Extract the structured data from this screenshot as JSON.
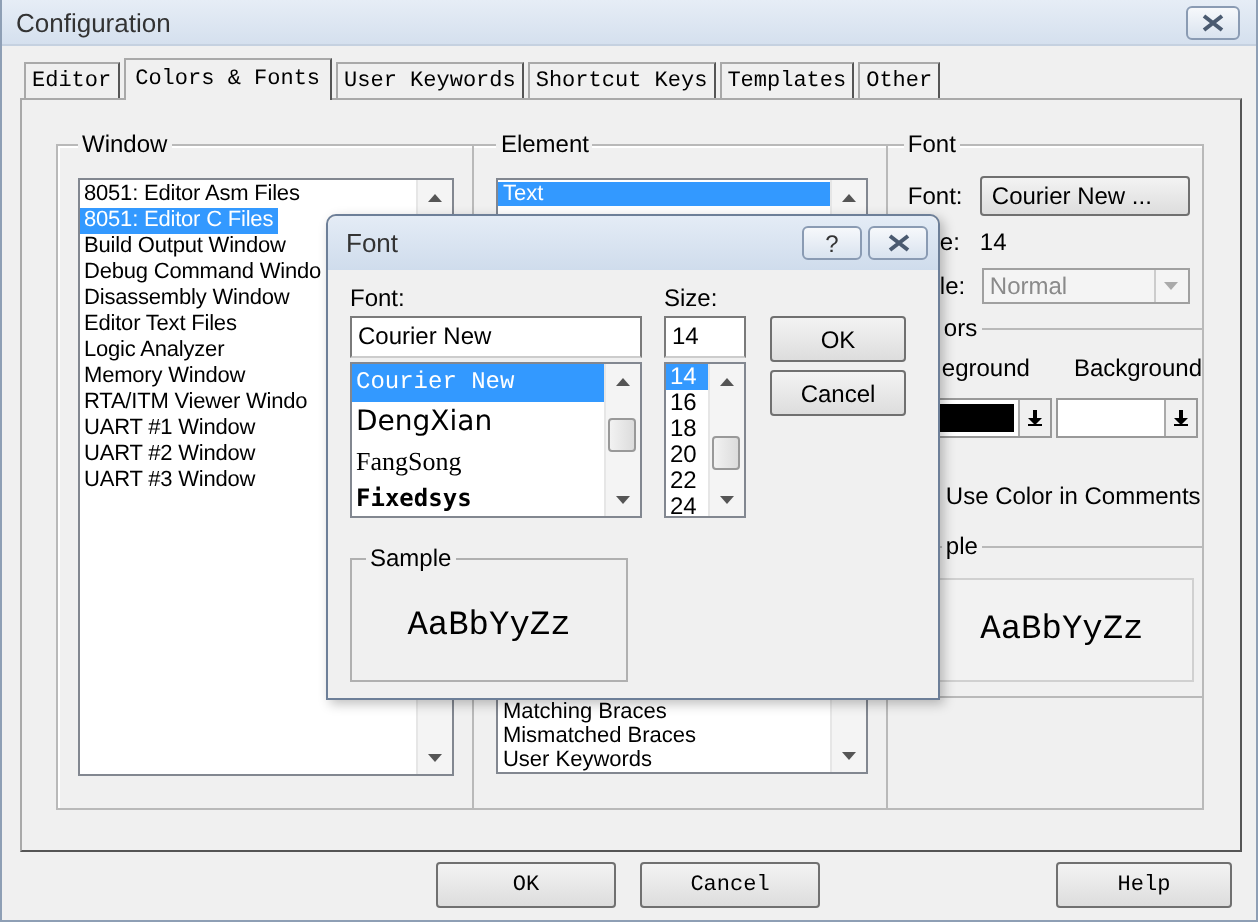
{
  "window": {
    "title": "Configuration"
  },
  "tabs": [
    {
      "label": "Editor",
      "selected": false
    },
    {
      "label": "Colors & Fonts",
      "selected": true
    },
    {
      "label": "User Keywords",
      "selected": false
    },
    {
      "label": "Shortcut Keys",
      "selected": false
    },
    {
      "label": "Templates",
      "selected": false
    },
    {
      "label": "Other",
      "selected": false
    }
  ],
  "window_group": {
    "legend": "Window",
    "items": [
      {
        "label": "8051: Editor Asm Files",
        "selected": false
      },
      {
        "label": "8051: Editor C Files",
        "selected": true
      },
      {
        "label": "Build Output Window",
        "selected": false
      },
      {
        "label": "Debug Command Windo",
        "selected": false
      },
      {
        "label": "Disassembly Window",
        "selected": false
      },
      {
        "label": "Editor Text Files",
        "selected": false
      },
      {
        "label": "Logic Analyzer",
        "selected": false
      },
      {
        "label": "Memory Window",
        "selected": false
      },
      {
        "label": "RTA/ITM Viewer Windo",
        "selected": false
      },
      {
        "label": "UART #1 Window",
        "selected": false
      },
      {
        "label": "UART #2 Window",
        "selected": false
      },
      {
        "label": "UART #3 Window",
        "selected": false
      }
    ]
  },
  "element_group": {
    "legend": "Element",
    "items_top": [
      {
        "label": "Text",
        "selected": true
      }
    ],
    "items_bottom": [
      {
        "label": "Matching Braces",
        "selected": false
      },
      {
        "label": "Mismatched Braces",
        "selected": false
      },
      {
        "label": "User Keywords",
        "selected": false
      }
    ]
  },
  "font_group": {
    "legend": "Font",
    "font_label": "Font:",
    "font_button": "Courier New ...",
    "size_label": "e:",
    "size_value": "14",
    "style_label": "le:",
    "style_value": "Normal",
    "style_disabled": true
  },
  "colors_group": {
    "legend": "ors",
    "foreground_label": "eground",
    "background_label": "Background",
    "comments_label": "Use Color in Comments"
  },
  "sample_group": {
    "legend": "ple",
    "text": "AaBbYyZz"
  },
  "buttons": [
    "OK",
    "Cancel",
    "Help"
  ],
  "font_dialog": {
    "title": "Font",
    "help_button": "?",
    "font_label": "Font:",
    "font_value": "Courier New",
    "fonts": [
      {
        "label": "Courier New",
        "kind": "mono",
        "selected": true
      },
      {
        "label": "DengXian",
        "kind": "sans",
        "selected": false
      },
      {
        "label": "FangSong",
        "kind": "serif",
        "selected": false
      },
      {
        "label": "Fixedsys",
        "kind": "bold-mono",
        "selected": false
      }
    ],
    "size_label": "Size:",
    "size_value": "14",
    "sizes": [
      {
        "label": "14",
        "selected": true
      },
      {
        "label": "16",
        "selected": false
      },
      {
        "label": "18",
        "selected": false
      },
      {
        "label": "20",
        "selected": false
      },
      {
        "label": "22",
        "selected": false
      },
      {
        "label": "24",
        "selected": false
      }
    ],
    "ok": "OK",
    "cancel": "Cancel",
    "sample_legend": "Sample",
    "sample_text": "AaBbYyZz"
  }
}
